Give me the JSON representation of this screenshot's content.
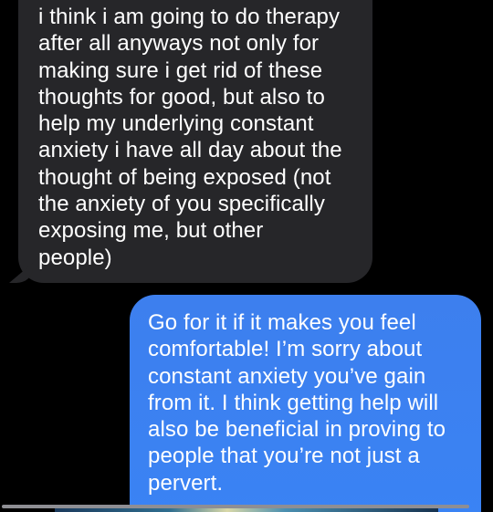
{
  "messages": [
    {
      "direction": "received",
      "text": "i think i am going to do therapy\nafter all anyways not only for\nmaking sure i get rid of these\nthoughts for good, but also to\nhelp my underlying constant\nanxiety i have all day about the\nthought of being exposed (not\nthe anxiety of you specifically\nexposing me, but other\npeople)"
    },
    {
      "direction": "sent",
      "text": "Go for it if it makes you feel\ncomfortable! I’m sorry about\nconstant anxiety you’ve gain\nfrom it. I think getting help will\nalso be beneficial in proving to\npeople that you’re not just a\npervert."
    }
  ],
  "colors": {
    "background": "#000000",
    "received_bubble": "#262629",
    "sent_bubble": "#3a83f4",
    "text": "#ffffff"
  }
}
